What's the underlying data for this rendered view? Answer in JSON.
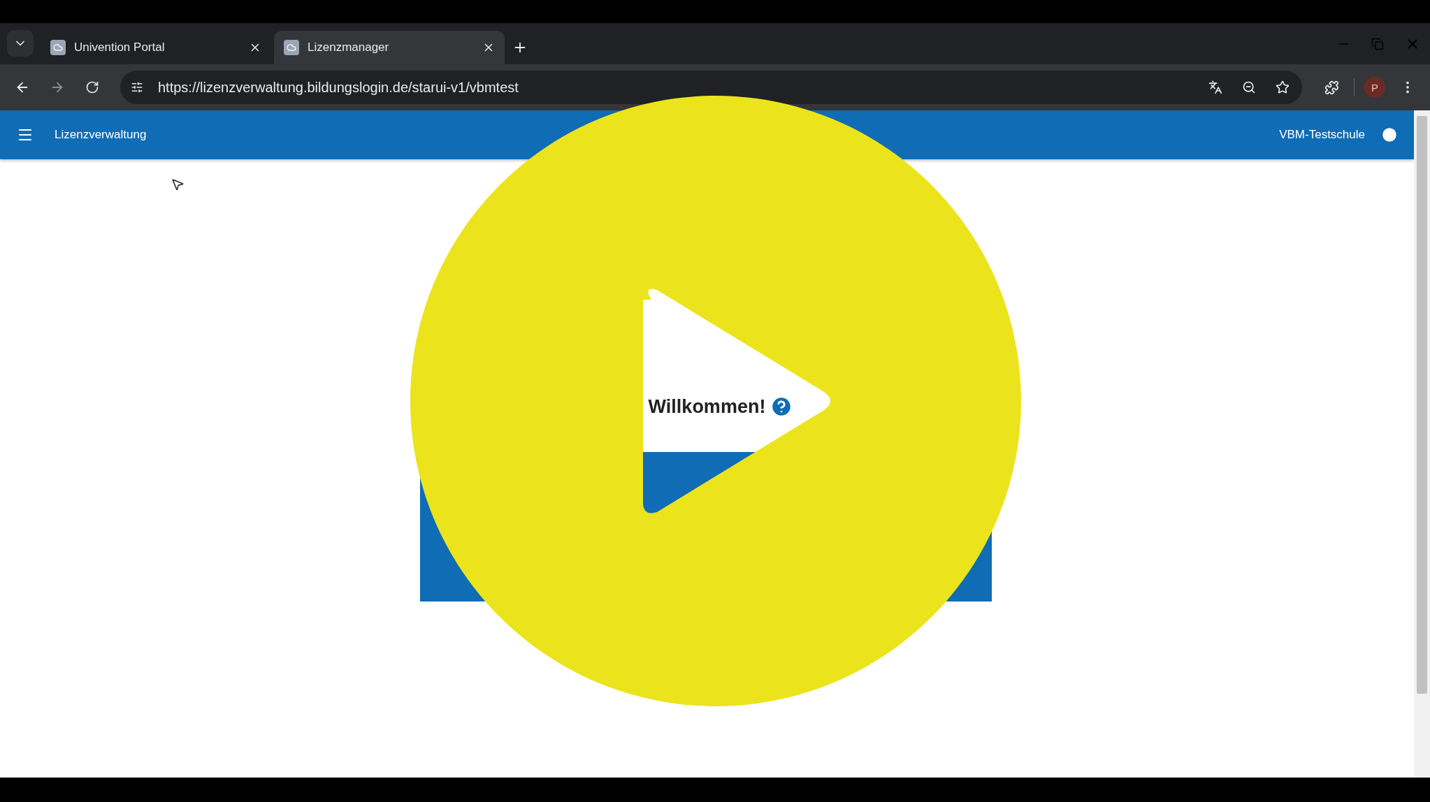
{
  "tabs": [
    {
      "title": "Univention Portal",
      "selected": false
    },
    {
      "title": "Lizenzmanager",
      "selected": true
    }
  ],
  "address_bar": {
    "url": "https://lizenzverwaltung.bildungslogin.de/starui-v1/vbmtest"
  },
  "profile": {
    "initial": "P"
  },
  "app_bar": {
    "title": "Lizenzverwaltung",
    "school": "VBM-Testschule"
  },
  "content": {
    "heading": "Willkommen!"
  }
}
